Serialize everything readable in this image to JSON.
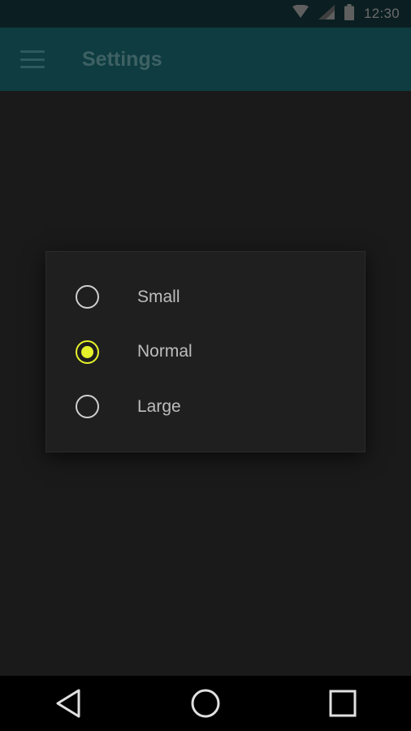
{
  "status_bar": {
    "time": "12:30",
    "icons": [
      "wifi-icon",
      "cell-signal-icon",
      "battery-icon"
    ]
  },
  "app_bar": {
    "title": "Settings",
    "menu_icon": "hamburger-menu-icon",
    "background": "#0e3c40"
  },
  "dialog": {
    "options": [
      {
        "label": "Small",
        "selected": false
      },
      {
        "label": "Normal",
        "selected": true
      },
      {
        "label": "Large",
        "selected": false
      }
    ],
    "accent": "#e6f22a"
  },
  "nav_bar": {
    "buttons": [
      "back-icon",
      "home-icon",
      "recents-icon"
    ]
  }
}
